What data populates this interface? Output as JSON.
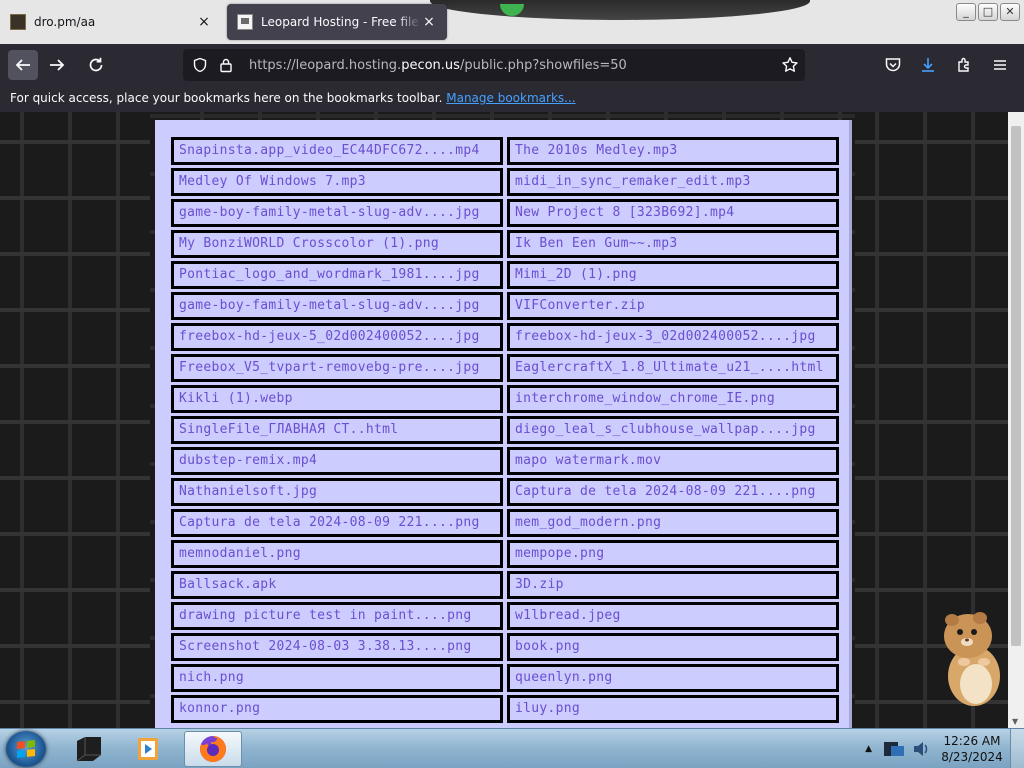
{
  "tabs": [
    {
      "title": "dro.pm/aa",
      "active": false
    },
    {
      "title": "Leopard Hosting - Free file hosting",
      "active": true
    }
  ],
  "tab_close_glyph": "×",
  "window_controls": [
    "_",
    "□",
    "✕"
  ],
  "url": {
    "scheme": "https://",
    "sub": "leopard.hosting.",
    "host": "pecon.us",
    "path": "/public.php?showfiles=50"
  },
  "bookmarks_bar": {
    "message": "For quick access, place your bookmarks here on the bookmarks toolbar.",
    "link": "Manage bookmarks..."
  },
  "files": [
    "Snapinsta.app_video_EC44DFC672....mp4",
    "The 2010s Medley.mp3",
    "Medley Of Windows 7.mp3",
    "midi_in_sync_remaker_edit.mp3",
    "game-boy-family-metal-slug-adv....jpg",
    "New Project 8 [323B692].mp4",
    "My BonziWORLD Crosscolor (1).png",
    "Ik Ben Een Gum~~.mp3",
    "Pontiac_logo_and_wordmark_1981....jpg",
    "Mimi_2D (1).png",
    "game-boy-family-metal-slug-adv....jpg",
    "VIFConverter.zip",
    "freebox-hd-jeux-5_02d002400052....jpg",
    "freebox-hd-jeux-3_02d002400052....jpg",
    "Freebox_V5_tvpart-removebg-pre....jpg",
    "EaglercraftX_1.8_Ultimate_u21_....html",
    "Kikli (1).webp",
    "interchrome_window_chrome_IE.png",
    "SingleFile_ГЛАВНАЯ СТ..html",
    "diego_leal_s_clubhouse_wallpap....jpg",
    "dubstep-remix.mp4",
    "mapo watermark.mov",
    "Nathanielsoft.jpg",
    "Captura de tela 2024-08-09 221....png",
    "Captura de tela 2024-08-09 221....png",
    "mem_god_modern.png",
    "memnodaniel.png",
    "mempope.png",
    "Ballsack.apk",
    "3D.zip",
    "drawing picture test in paint....png",
    "w1lbread.jpeg",
    "Screenshot 2024-08-03 3.38.13....png",
    "book.png",
    "nich.png",
    "queenlyn.png",
    "konnor.png",
    "iluy.png"
  ],
  "clock": {
    "time": "12:26 AM",
    "date": "8/23/2024"
  },
  "colors": {
    "panel": "#ccccff",
    "file_text": "#6a4fd0",
    "link": "#45a1ff"
  }
}
